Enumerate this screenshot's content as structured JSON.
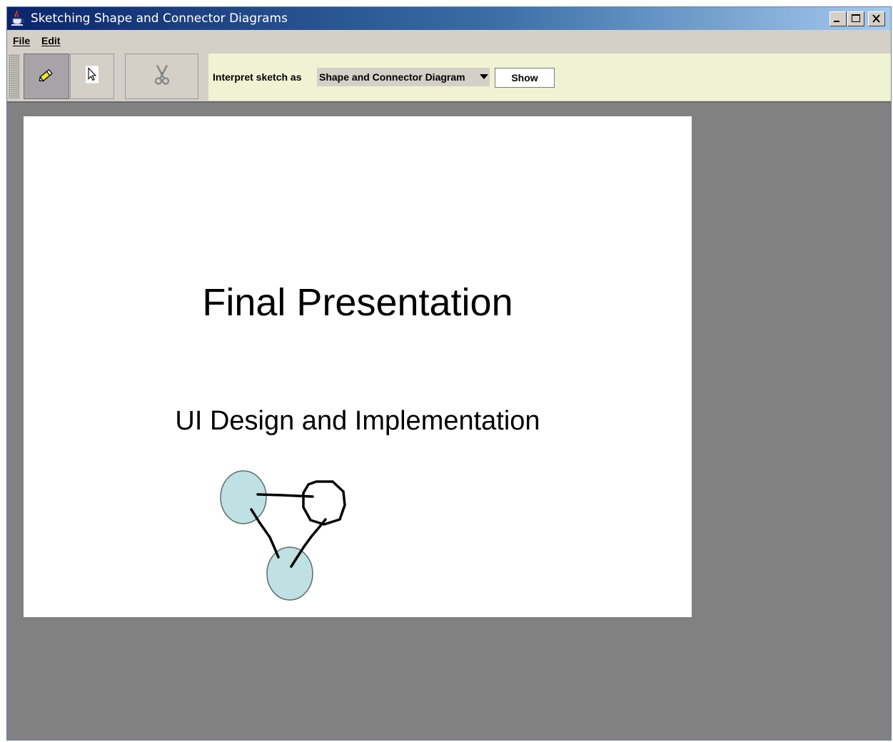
{
  "window": {
    "title": "Sketching Shape and Connector Diagrams",
    "app_icon": "java-cup-icon",
    "controls": {
      "minimize_icon": "minimize-icon",
      "maximize_icon": "maximize-icon",
      "close_icon": "close-icon"
    }
  },
  "menubar": {
    "items": [
      {
        "label": "File"
      },
      {
        "label": "Edit"
      }
    ]
  },
  "toolbar": {
    "tools": [
      {
        "icon": "pen-icon",
        "selected": true
      },
      {
        "icon": "pointer-icon",
        "selected": false
      },
      {
        "icon": "scissors-icon",
        "enabled": false
      }
    ],
    "interpret_label": "Interpret sketch as",
    "interpret_select": {
      "value": "Shape and Connector Diagram"
    },
    "show_label": "Show"
  },
  "canvas": {
    "title": "Final Presentation",
    "subtitle": "UI Design and Implementation",
    "sketch": {
      "shapes": [
        {
          "kind": "ellipse",
          "fill": "#bfe1e3"
        },
        {
          "kind": "octagon",
          "fill": "none"
        },
        {
          "kind": "ellipse",
          "fill": "#bfe1e3"
        }
      ],
      "connectors": 3
    }
  },
  "colors": {
    "titlebar_start": "#0a246a",
    "titlebar_end": "#a6caf0",
    "workspace": "#828182",
    "interpret_panel": "#eff3d3",
    "shape_fill": "#bfe1e3"
  }
}
